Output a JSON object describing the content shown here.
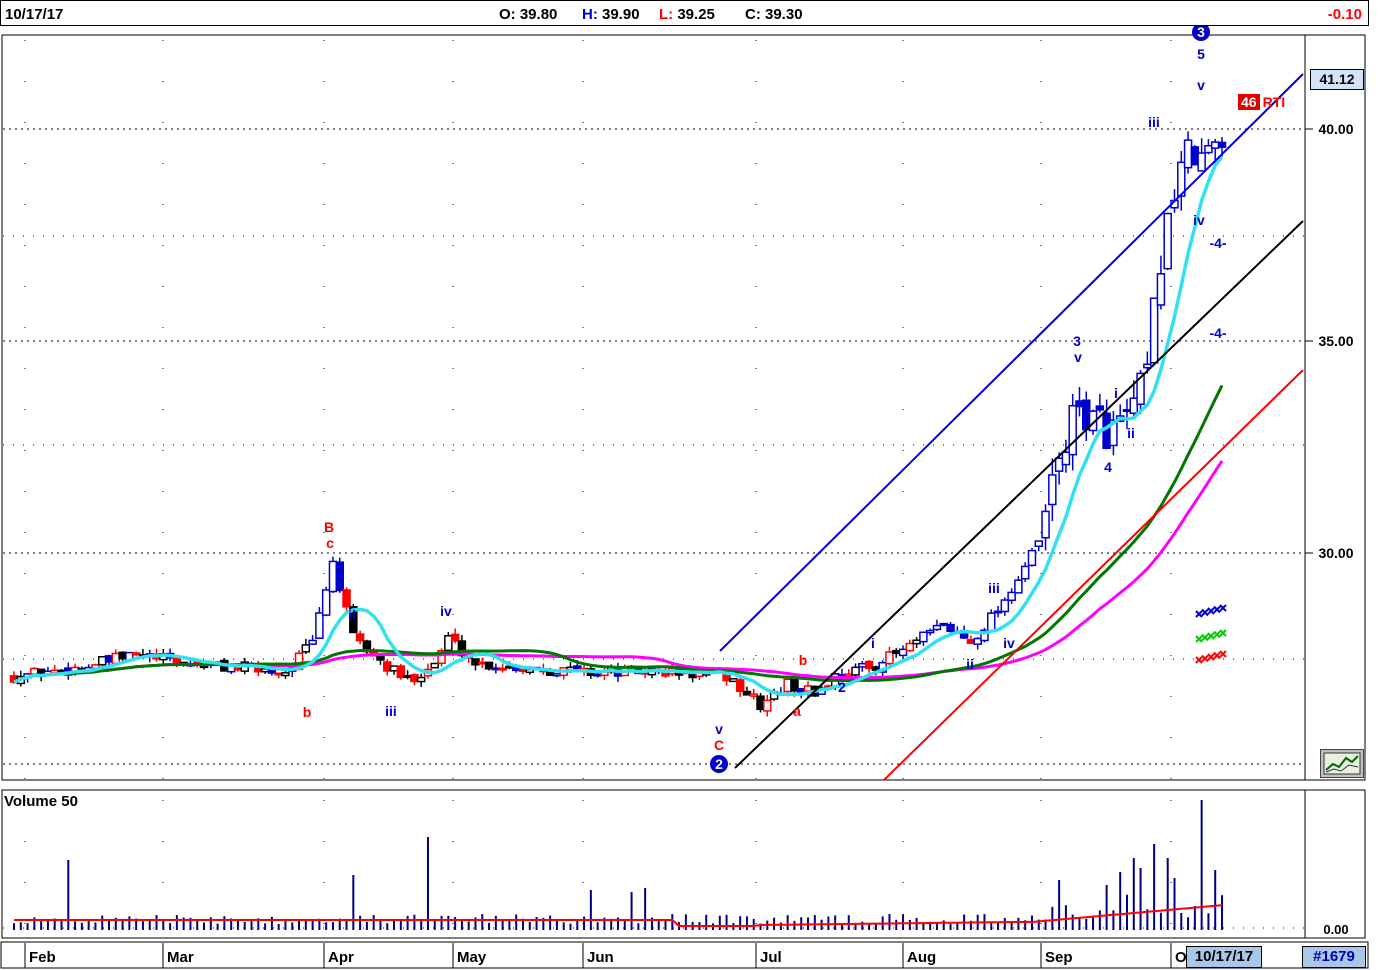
{
  "header": {
    "date": "10/17/17",
    "open_label": "O:",
    "open": "39.80",
    "high_label": "H:",
    "high": "39.90",
    "low_label": "L:",
    "low": "39.25",
    "close_label": "C:",
    "close": "39.30",
    "change": "-0.10"
  },
  "price_tag": "41.12",
  "rsi": {
    "value": "46",
    "label": "RTI"
  },
  "volume_title": "Volume 50",
  "footer": {
    "date_box": "10/17/17",
    "count_box": "#1679"
  },
  "chart_data": {
    "type": "candlestick",
    "yticks": [
      "40.00",
      "35.00",
      "30.00"
    ],
    "volume_ytick": "0.00",
    "months": [
      "Feb",
      "Mar",
      "Apr",
      "May",
      "Jun",
      "Jul",
      "Aug",
      "Sep",
      "O"
    ],
    "wave_labels": [
      {
        "text": "B",
        "color": "red"
      },
      {
        "text": "c",
        "color": "red"
      },
      {
        "text": "b",
        "color": "red"
      },
      {
        "text": "ii",
        "color": "blue"
      },
      {
        "text": "iii",
        "color": "blue"
      },
      {
        "text": "iv",
        "color": "blue"
      },
      {
        "text": "v",
        "color": "blue"
      },
      {
        "text": "C",
        "color": "red"
      },
      {
        "text": "2",
        "color": "blue",
        "circled": true
      },
      {
        "text": "b",
        "color": "red"
      },
      {
        "text": "a",
        "color": "red"
      },
      {
        "text": "2",
        "color": "blue"
      },
      {
        "text": "i",
        "color": "blue"
      },
      {
        "text": "ii",
        "color": "blue"
      },
      {
        "text": "iii",
        "color": "blue"
      },
      {
        "text": "iv",
        "color": "blue"
      },
      {
        "text": "3",
        "color": "blue"
      },
      {
        "text": "v",
        "color": "blue"
      },
      {
        "text": "4",
        "color": "blue"
      },
      {
        "text": "i",
        "color": "blue"
      },
      {
        "text": "ii",
        "color": "blue"
      },
      {
        "text": "iii",
        "color": "blue"
      },
      {
        "text": "iv",
        "color": "blue"
      },
      {
        "text": "v",
        "color": "blue"
      },
      {
        "text": "5",
        "color": "blue"
      },
      {
        "text": "3",
        "color": "blue",
        "circled": true
      },
      {
        "text": "-4-",
        "color": "blue"
      },
      {
        "text": "-4-",
        "color": "blue"
      }
    ]
  }
}
